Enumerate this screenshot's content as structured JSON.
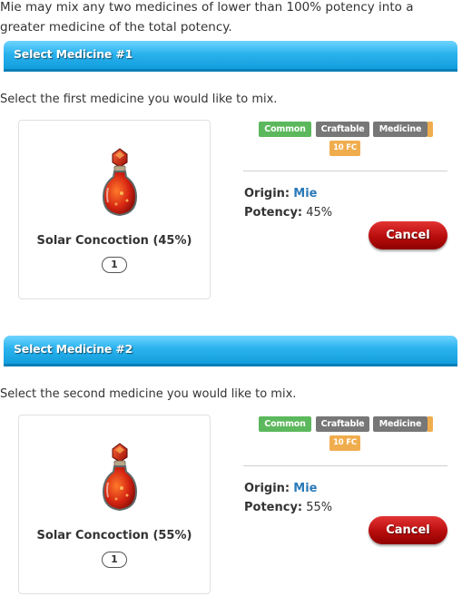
{
  "intro_text": "Mie may mix any two medicines of lower than 100% potency into a greater medicine of the total potency.",
  "colors": {
    "header_blue": "#2bb3ee",
    "common_tag": "#5cb85c",
    "grey_tag": "#777777",
    "fc_tag": "#f0ad4e",
    "origin_link": "#2a7ab8",
    "cancel_red": "#b80d0d"
  },
  "sections": [
    {
      "title": "Select Medicine #1",
      "instruction": "Select the first medicine you would like to mix.",
      "item": {
        "icon": "red-potion-bottle-icon",
        "name": "Solar Concoction (45%)",
        "quantity": "1",
        "tags": [
          "Common",
          "Craftable",
          "Medicine"
        ],
        "price_tag": "10 FC",
        "origin_label": "Origin:",
        "origin_value": "Mie",
        "potency_label": "Potency:",
        "potency_value": "45%"
      },
      "cancel_label": "Cancel"
    },
    {
      "title": "Select Medicine #2",
      "instruction": "Select the second medicine you would like to mix.",
      "item": {
        "icon": "red-potion-bottle-icon",
        "name": "Solar Concoction (55%)",
        "quantity": "1",
        "tags": [
          "Common",
          "Craftable",
          "Medicine"
        ],
        "price_tag": "10 FC",
        "origin_label": "Origin:",
        "origin_value": "Mie",
        "potency_label": "Potency:",
        "potency_value": "55%"
      },
      "cancel_label": "Cancel"
    }
  ]
}
